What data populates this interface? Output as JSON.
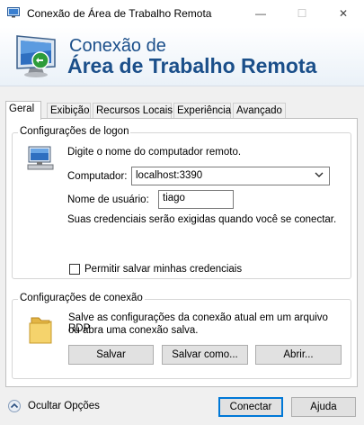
{
  "window": {
    "title": "Conexão de Área de Trabalho Remota",
    "controls": {
      "minimize": "—",
      "maximize": "☐",
      "close": "✕"
    }
  },
  "banner": {
    "line1": "Conexão de",
    "line2": "Área de Trabalho Remota",
    "icon": "remote-desktop-icon"
  },
  "tabs": [
    {
      "label": "Geral",
      "active": true
    },
    {
      "label": "Exibição"
    },
    {
      "label": "Recursos Locais"
    },
    {
      "label": "Experiência"
    },
    {
      "label": "Avançado"
    }
  ],
  "logon": {
    "group_title": "Configurações de logon",
    "intro": "Digite o nome do computador remoto.",
    "computer_label": "Computador:",
    "computer_value": "localhost:3390",
    "username_label": "Nome de usuário:",
    "username_value": "tiago",
    "credentials_note": "Suas credenciais serão exigidas quando você se conectar.",
    "save_credentials_label": "Permitir salvar minhas credenciais",
    "save_credentials_checked": false
  },
  "connection": {
    "group_title": "Configurações de conexão",
    "description_line1": "Salve as configurações da conexão atual em um arquivo RDP",
    "description_line2": "ou abra uma conexão salva.",
    "save_label": "Salvar",
    "save_as_label": "Salvar como...",
    "open_label": "Abrir..."
  },
  "footer": {
    "hide_options_label": "Ocultar Opções",
    "connect_label": "Conectar",
    "help_label": "Ajuda"
  },
  "colors": {
    "banner_text": "#1b4f8a",
    "primary_border": "#0078d7"
  }
}
